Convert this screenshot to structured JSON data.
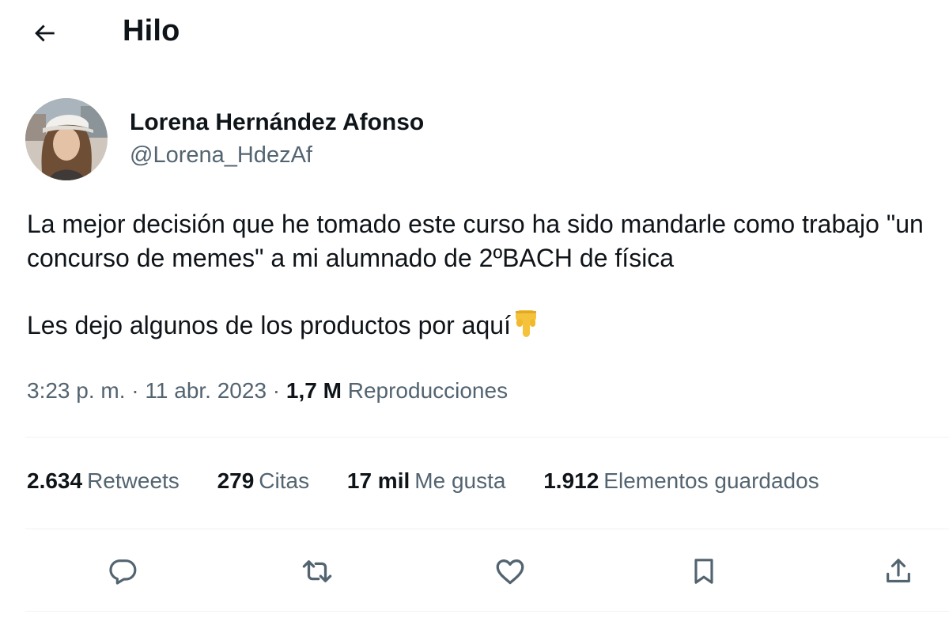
{
  "header": {
    "title": "Hilo",
    "back_icon": "arrow-left-icon"
  },
  "author": {
    "name": "Lorena Hernández Afonso",
    "handle": "@Lorena_HdezAf"
  },
  "tweet": {
    "paragraph1": "La mejor decisión que he tomado este curso ha sido mandarle como trabajo \"un concurso de memes\" a mi alumnado de 2ºBACH de física",
    "paragraph2": "Les dejo algunos de los productos por aquí",
    "emoji": "backhand-index-pointing-down"
  },
  "meta": {
    "time": "3:23 p. m.",
    "sep1": " · ",
    "date": "11 abr. 2023",
    "sep2": " · ",
    "views_count": "1,7 M",
    "views_label": "Reproducciones"
  },
  "stats": [
    {
      "count": "2.634",
      "label": "Retweets"
    },
    {
      "count": "279",
      "label": "Citas"
    },
    {
      "count": "17 mil",
      "label": "Me gusta"
    },
    {
      "count": "1.912",
      "label": "Elementos guardados"
    }
  ],
  "actions": [
    "reply-icon",
    "retweet-icon",
    "like-icon",
    "bookmark-icon",
    "share-icon"
  ],
  "colors": {
    "text": "#0f1419",
    "secondary": "#536471",
    "divider": "#eff3f4",
    "emoji": "#f5c33b"
  }
}
